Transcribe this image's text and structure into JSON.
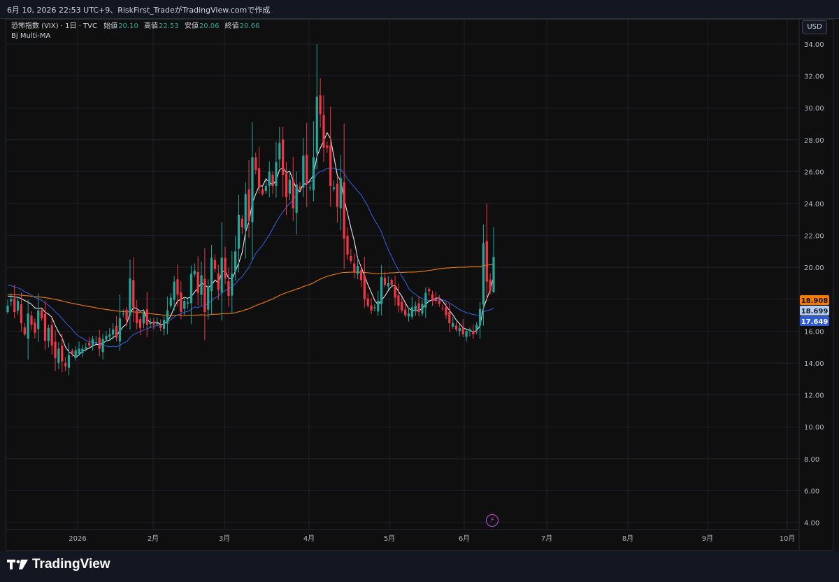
{
  "header": {
    "caption": "6月 10, 2026 22:53 UTC+9、RiskFirst_TradeがTradingView.comで作成"
  },
  "legend": {
    "symbol": "恐怖指数 (VIX) · 1日 · TVC",
    "open_label": "始値",
    "open_value": "20.10",
    "high_label": "高値",
    "high_value": "22.53",
    "low_label": "安値",
    "low_value": "20.06",
    "close_label": "終値",
    "close_value": "20.66",
    "indicator": "Bj Multi-MA"
  },
  "currency": "USD",
  "brand": {
    "name": "TradingView"
  },
  "colors": {
    "up": "#26a69a",
    "down": "#f23645",
    "ma_fast": "#e3e6ef",
    "ma_mid": "#2f5bd3",
    "ma_slow": "#f57c00",
    "bg": "#0f0f0f"
  },
  "chart_data": {
    "type": "candlestick",
    "y_axis": {
      "min": 4,
      "max": 34,
      "ticks": [
        34,
        32,
        30,
        28,
        26,
        24,
        22,
        20,
        18,
        16,
        14,
        12,
        10,
        8,
        6,
        4
      ],
      "side": "right"
    },
    "x_axis_labels": [
      "2026",
      "2月",
      "3月",
      "4月",
      "5月",
      "6月",
      "7月",
      "8月",
      "9月",
      "10月"
    ],
    "price_badges": [
      {
        "value": "18.908",
        "color": "#f57c00",
        "text_color": "#131722"
      },
      {
        "value": "18.699",
        "color": "#b3cdf3",
        "text_color": "#131722"
      },
      {
        "value": "17.649",
        "color": "#2f5bd3",
        "text_color": "#ffffff"
      }
    ],
    "grid": true,
    "candle_closes": [
      17.6,
      18.0,
      17.2,
      17.9,
      16.5,
      15.8,
      17.1,
      16.4,
      15.9,
      17.3,
      16.8,
      15.4,
      16.2,
      15.1,
      14.3,
      14.9,
      14.1,
      13.8,
      14.5,
      14.6,
      14.8,
      14.9,
      14.9,
      15.0,
      15.1,
      15.5,
      15.3,
      14.9,
      15.5,
      15.7,
      15.8,
      16.1,
      15.6,
      16.8,
      17.1,
      16.7,
      19.3,
      17.5,
      16.5,
      16.2,
      17.1,
      16.4,
      16.5,
      16.4,
      16.5,
      16.2,
      16.7,
      17.3,
      18.1,
      19.1,
      18.3,
      17.2,
      17.9,
      17.8,
      19.6,
      19.8,
      18.4,
      19.5,
      17.2,
      18.8,
      20.6,
      19.9,
      18.6,
      20.6,
      19.3,
      18.2,
      19.6,
      21.0,
      23.3,
      22.5,
      24.6,
      22.9,
      26.9,
      26.1,
      25.0,
      24.6,
      25.1,
      26.0,
      25.1,
      26.6,
      27.8,
      25.8,
      24.4,
      25.5,
      23.7,
      25.2,
      24.9,
      27.0,
      25.2,
      25.0,
      26.9,
      30.7,
      29.6,
      27.5,
      27.5,
      25.1,
      25.0,
      23.8,
      25.6,
      21.8,
      20.8,
      20.4,
      19.7,
      20.1,
      19.2,
      18.0,
      17.6,
      17.3,
      17.5,
      17.9,
      19.4,
      18.9,
      19.0,
      18.9,
      18.1,
      17.6,
      17.3,
      17.0,
      17.1,
      17.5,
      17.6,
      17.2,
      17.7,
      18.4,
      18.5,
      17.9,
      17.9,
      17.7,
      17.4,
      17.0,
      16.5,
      16.5,
      16.1,
      16.2,
      15.8,
      16.0,
      16.1,
      15.8,
      16.4,
      17.4,
      21.5,
      19.1,
      18.5,
      20.66
    ]
  }
}
